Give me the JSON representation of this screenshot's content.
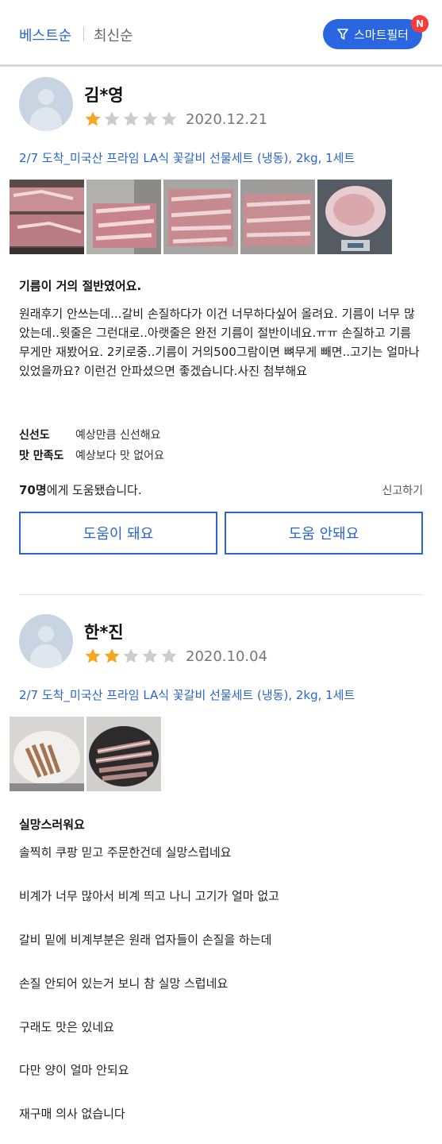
{
  "sort": {
    "best": "베스트순",
    "newest": "최신순"
  },
  "smart_filter": {
    "label": "스마트필터",
    "badge": "N"
  },
  "colors": {
    "accent": "#2a66cc",
    "star_on": "#f5a623",
    "star_off": "#cccccc",
    "badge": "#ff3838"
  },
  "reviews": [
    {
      "name": "김*영",
      "rating": 1,
      "date": "2020.12.21",
      "product": "2/7 도착_미국산 프라임 LA식 꽃갈비 선물세트 (냉동), 2kg, 1세트",
      "photos": [
        "meat-photo-1",
        "meat-photo-2",
        "meat-photo-3",
        "meat-photo-4",
        "fat-on-scale-photo"
      ],
      "title": "기름이 거의 절반였어요.",
      "body": "원래후기 안쓰는데...갈비 손질하다가 이건 너무하다싶어 올려요. 기름이 너무 많았는데..윗줄은 그런대로..아랫줄은 완전 기름이 절반이네요.ㅠㅠ 손질하고 기름 무게만 재봤어요. 2키로중..기름이 거의500그람이면 뼈무게 빼면..고기는 얼마나 있었을까요? 이런건 안파셨으면 좋겠습니다.사진 첨부해요",
      "freshness_label": "신선도",
      "freshness_value": "예상만큼 신선해요",
      "taste_label": "맛 만족도",
      "taste_value": "예상보다 맛 없어요",
      "helpful_count": "70명",
      "helpful_suffix": "에게 도움됐습니다.",
      "report": "신고하기",
      "helpful_yes": "도움이 돼요",
      "helpful_no": "도움 안돼요"
    },
    {
      "name": "한*진",
      "rating": 2,
      "date": "2020.10.04",
      "product": "2/7 도착_미국산 프라임 LA식 꽃갈비 선물세트 (냉동), 2kg, 1세트",
      "photos": [
        "cooked-ribs-plate-photo",
        "ribs-in-pan-photo"
      ],
      "title": "실망스러워요",
      "paragraphs": [
        "솔찍히 쿠팡 믿고 주문한건데 실망스럽네요",
        "비계가 너무 많아서 비계 띄고 나니 고기가 얼마 없고",
        "갈비 밑에 비계부분은 원래 업자들이 손질을 하는데",
        "손질 안되어 있는거 보니 참 실망 스럽네요",
        "구래도 맛은 있네요",
        "다만 양이 얼마 안되요",
        "재구매 의사 없습니다"
      ]
    }
  ]
}
